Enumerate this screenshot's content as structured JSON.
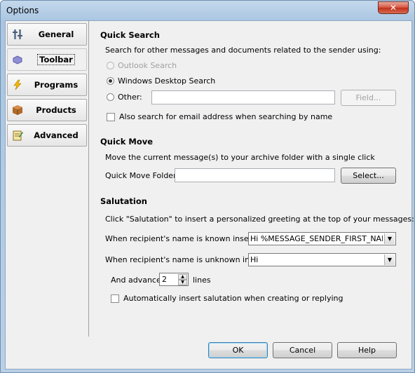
{
  "window": {
    "title": "Options",
    "close_glyph": "✕"
  },
  "sidebar": {
    "items": [
      {
        "label": "General",
        "icon": "tools-icon"
      },
      {
        "label": "Toolbar",
        "icon": "toolbar-icon"
      },
      {
        "label": "Programs",
        "icon": "lightning-icon"
      },
      {
        "label": "Products",
        "icon": "box-icon"
      },
      {
        "label": "Advanced",
        "icon": "notepad-icon"
      }
    ],
    "selected": "Toolbar"
  },
  "quick_search": {
    "title": "Quick Search",
    "description": "Search for other messages and documents related to the sender using:",
    "outlook_label": "Outlook Search",
    "windows_label": "Windows Desktop Search",
    "other_label": "Other:",
    "other_value": "",
    "field_button": "Field...",
    "email_checkbox_label": "Also search for email address when searching by name",
    "selected_option": "Windows Desktop Search"
  },
  "quick_move": {
    "title": "Quick Move",
    "description": "Move the current message(s) to your archive folder with a single click",
    "folder_label": "Quick Move Folder:",
    "folder_value": "",
    "select_button": "Select..."
  },
  "salutation": {
    "title": "Salutation",
    "description": "Click \"Salutation\" to insert a personalized greeting at the top of your messages:",
    "known_label": "When recipient's name is known insert:",
    "known_value": "Hi %MESSAGE_SENDER_FIRST_NAME%",
    "unknown_label": "When recipient's name is unknown insert:",
    "unknown_value": "Hi",
    "advance_label": "And advance",
    "advance_value": "2",
    "advance_unit": "lines",
    "auto_insert_label": "Automatically insert salutation when creating or replying"
  },
  "footer": {
    "ok": "OK",
    "cancel": "Cancel",
    "help": "Help"
  },
  "colors": {
    "title_gradient": "#b9d0e7",
    "close_red": "#c0301c",
    "default_border": "#3c7fb1"
  }
}
